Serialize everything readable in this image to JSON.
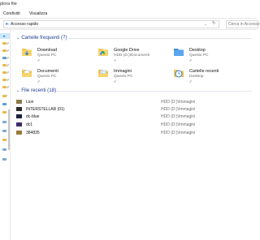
{
  "window": {
    "title": "plora file"
  },
  "ribbon": {
    "tabs": [
      "Condividi",
      "Visualizza"
    ]
  },
  "address": {
    "path": "Accesso rapido",
    "search_placeholder": "Cerca in Accesso"
  },
  "frequent": {
    "header": "Cartelle frequenti (7)",
    "items": [
      {
        "name": "Download",
        "sub": "Questo PC",
        "icon": "download-folder-icon"
      },
      {
        "name": "Google Drive",
        "sub": "HDD (D:)\\Documenti",
        "icon": "google-drive-folder-icon"
      },
      {
        "name": "Desktop",
        "sub": "Questo PC",
        "icon": "desktop-folder-icon"
      },
      {
        "name": "Documenti",
        "sub": "Questo PC",
        "icon": "documents-folder-icon"
      },
      {
        "name": "Immagini",
        "sub": "Questo PC",
        "icon": "pictures-folder-icon"
      },
      {
        "name": "Cartelle recenti",
        "sub": "Desktop",
        "icon": "recent-folders-icon"
      }
    ]
  },
  "recent": {
    "header": "File recenti (18)",
    "items": [
      {
        "name": "Lion",
        "location": "HDD (D:)\\Immagini",
        "thumb_color": "#8a7a4a"
      },
      {
        "name": "INTERSTELLAR (01)",
        "location": "HDD (D:)\\Immagini",
        "thumb_color": "#2a2a2a"
      },
      {
        "name": "dc-blue",
        "location": "HDD (D:)\\Immagini",
        "thumb_color": "#1c2140"
      },
      {
        "name": "dc1",
        "location": "HDD (D:)\\Immagini",
        "thumb_color": "#3d2a6a"
      },
      {
        "name": "384835",
        "location": "HDD (D:)\\Immagini",
        "thumb_color": "#9a7a3a"
      }
    ]
  }
}
